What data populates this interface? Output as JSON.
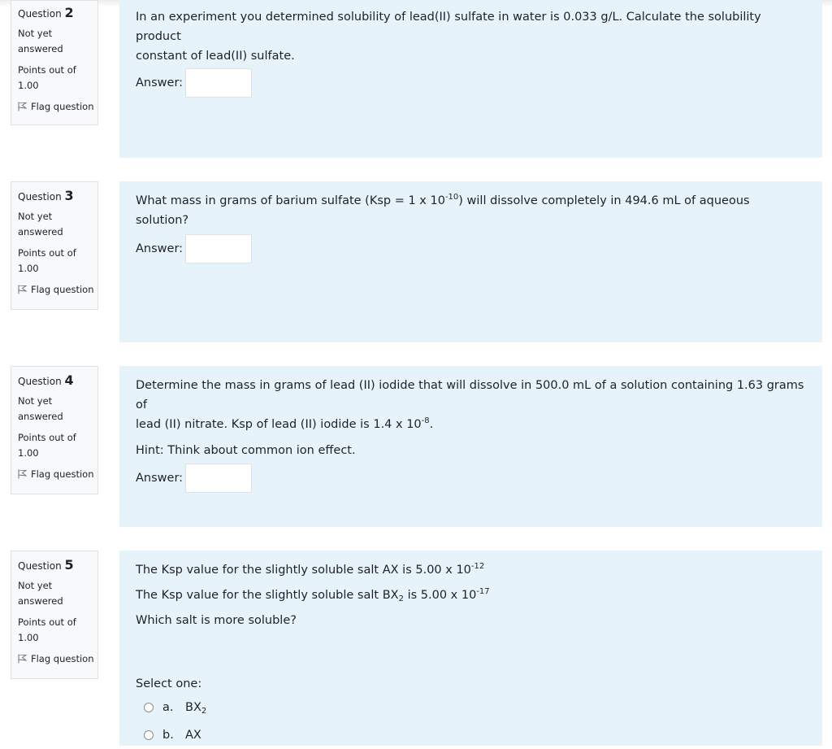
{
  "questions": [
    {
      "number": "2",
      "label": "Question",
      "state": "Not yet answered",
      "grade": "Points out of 1.00",
      "flag_label": "Flag question",
      "text_lines": [
        "In an experiment you determined solubility of lead(II) sulfate in water is 0.033 g/L. Calculate the solubility product",
        "constant of lead(II) sulfate."
      ],
      "answer_label": "Answer:",
      "answer_value": ""
    },
    {
      "number": "3",
      "label": "Question",
      "state": "Not yet answered",
      "grade": "Points out of 1.00",
      "flag_label": "Flag question",
      "text_pre": "What mass in grams of barium sulfate (Ksp = 1 x 10",
      "text_sup": "-10",
      "text_post": ") will dissolve completely in 494.6 mL of aqueous solution?",
      "answer_label": "Answer:",
      "answer_value": ""
    },
    {
      "number": "4",
      "label": "Question",
      "state": "Not yet answered",
      "grade": "Points out of 1.00",
      "flag_label": "Flag question",
      "text_line1": "Determine the mass in grams of lead (II) iodide that will dissolve in 500.0 mL of a solution containing 1.63 grams of",
      "text_line2_pre": "lead (II) nitrate. Ksp of lead (II) iodide is 1.4 x 10",
      "text_line2_sup": "-8",
      "text_line2_post": ".",
      "hint": "Hint: Think about common ion effect.",
      "answer_label": "Answer:",
      "answer_value": ""
    },
    {
      "number": "5",
      "label": "Question",
      "state": "Not yet answered",
      "grade": "Points out of 1.00",
      "flag_label": "Flag question",
      "line1_pre": "The Ksp value for the slightly soluble salt AX is 5.00 x 10",
      "line1_sup": "-12",
      "line2_pre": "The Ksp value for the slightly soluble salt BX",
      "line2_sub": "2",
      "line2_mid": " is 5.00 x 10",
      "line2_sup": "-17",
      "line3": "Which salt is more soluble?",
      "select_prompt": "Select one:",
      "options": [
        {
          "letter": "a.",
          "text": "BX",
          "sub": "2"
        },
        {
          "letter": "b.",
          "text": "AX",
          "sub": ""
        }
      ]
    }
  ]
}
